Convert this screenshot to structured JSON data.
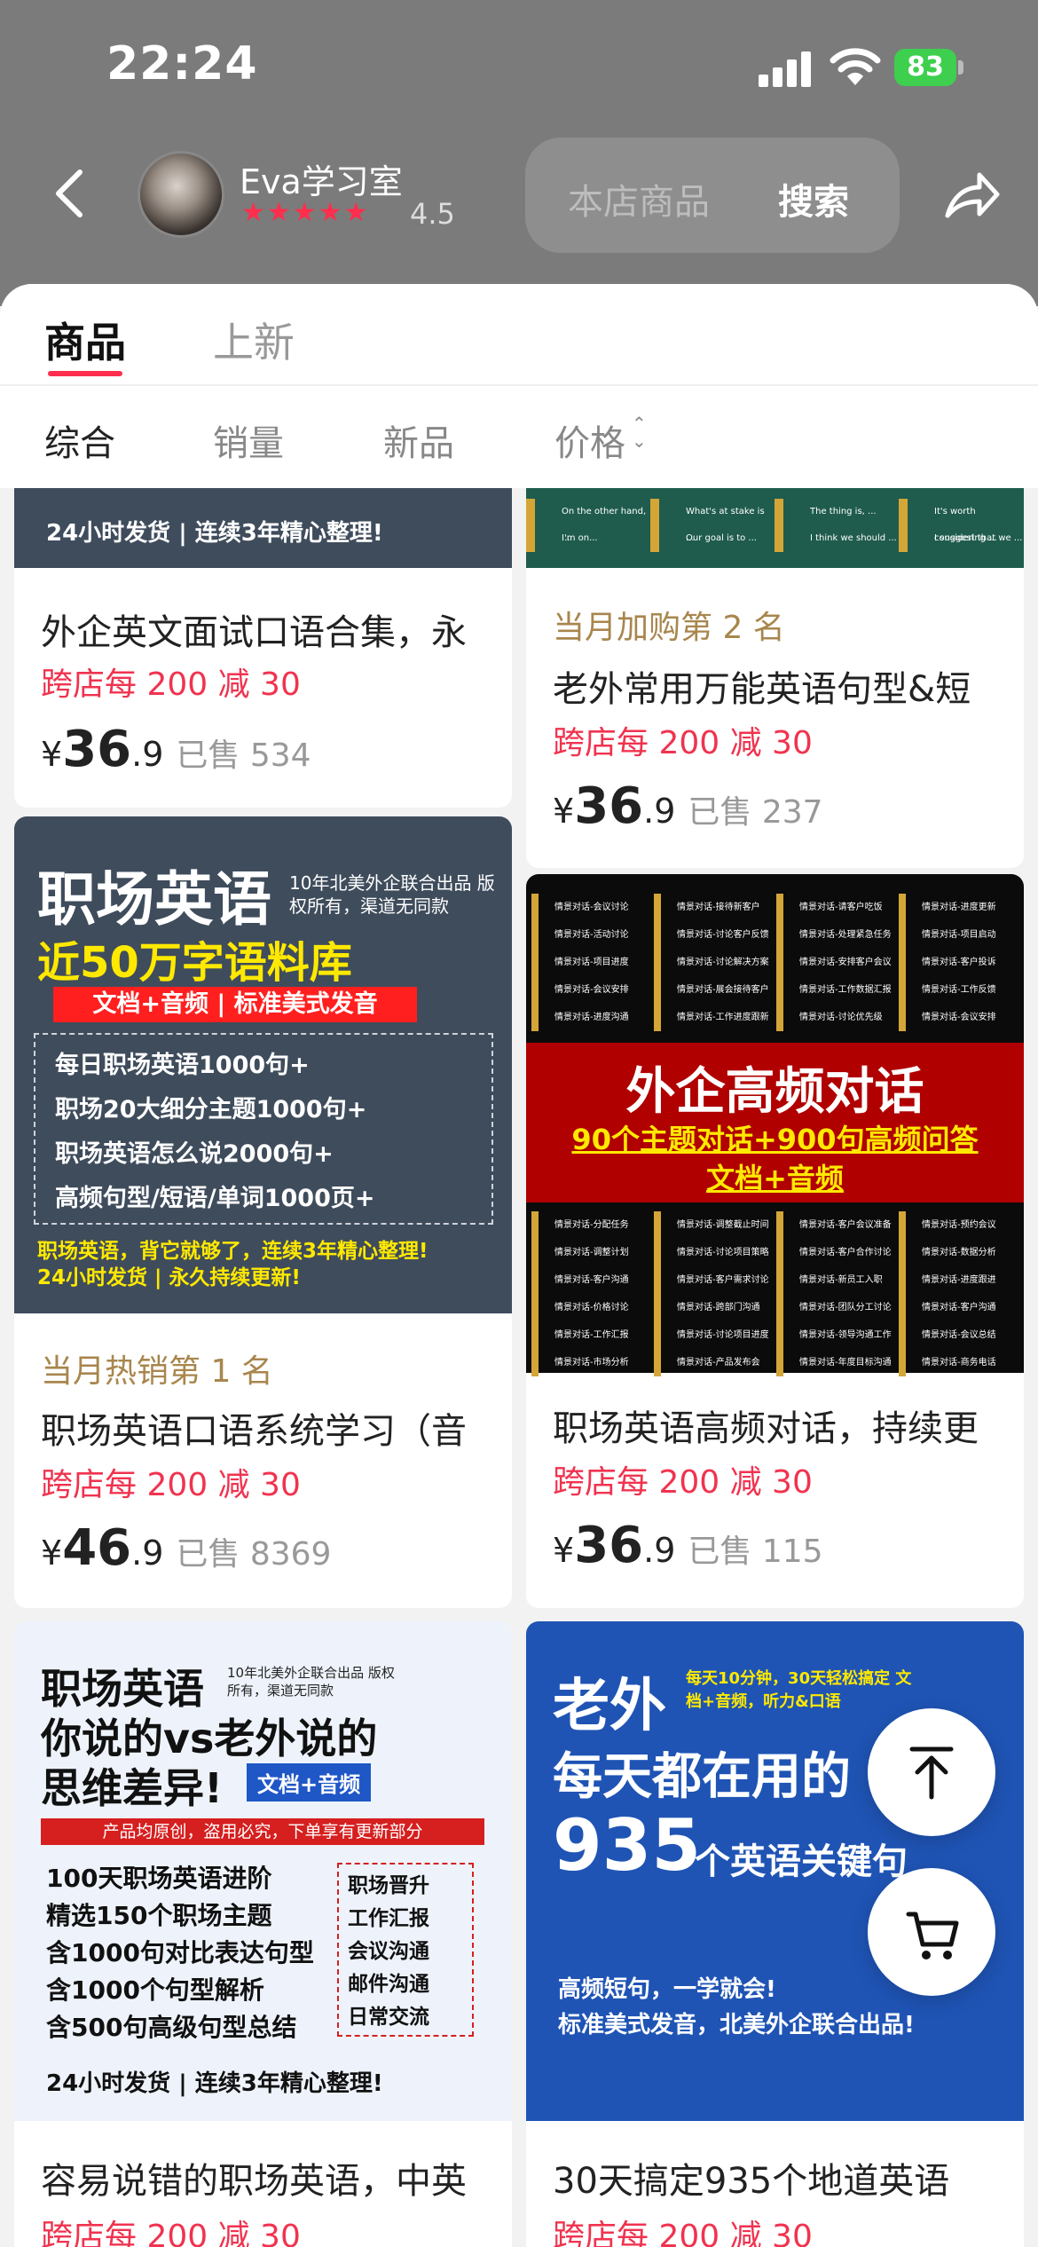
{
  "status_bar": {
    "time": "22:24",
    "battery": "83"
  },
  "shop": {
    "name": "Eva学习室",
    "stars": "★★★★★",
    "rating": "4.5"
  },
  "search": {
    "placeholder": "本店商品",
    "button": "搜索"
  },
  "tabs": [
    {
      "label": "商品"
    },
    {
      "label": "上新"
    }
  ],
  "sort": [
    "综合",
    "销量",
    "新品",
    "价格"
  ],
  "products": [
    {
      "banner": "24小时发货 | 连续3年精心整理!",
      "title": "外企英文面试口语合集，永",
      "rank": "",
      "promo": "跨店每 200 减 30",
      "currency": "¥",
      "price_int": "36",
      "price_dec": ".9",
      "sold": "已售 534"
    },
    {
      "chips": [
        "On the other hand, ...",
        "What's at stake is ...",
        "The thing is, ...",
        "It's worth considering ...",
        "I'm on...",
        "Our goal is to ...",
        "I think we should ...",
        "I suggest that we ..."
      ],
      "title": "老外常用万能英语句型&短",
      "rank": "当月加购第 2 名",
      "promo": "跨店每 200 减 30",
      "currency": "¥",
      "price_int": "36",
      "price_dec": ".9",
      "sold": "已售 237"
    },
    {
      "img": {
        "h1": "职场英语",
        "note": "10年北美外企联合出品 版权所有，渠道无同款",
        "h2": "近50万字语料库",
        "bar": "文档+音频 | 标准美式发音",
        "items": [
          "每日职场英语1000句+",
          "职场20大细分主题1000句+",
          "职场英语怎么说2000句+",
          "高频句型/短语/单词1000页+"
        ],
        "foot1": "职场英语，背它就够了，连续3年精心整理!",
        "foot2": "24小时发货 | 永久持续更新!"
      },
      "title": "职场英语口语系统学习（音",
      "rank": "当月热销第 1 名",
      "promo": "跨店每 200 减 30",
      "currency": "¥",
      "price_int": "46",
      "price_dec": ".9",
      "sold": "已售 8369"
    },
    {
      "img": {
        "h1": "外企高频对话",
        "h2": "90个主题对话+900句高频问答",
        "h3": "文档+音频",
        "chips_top": [
          "情景对话-会议讨论",
          "情景对话-接待新客户",
          "情景对话-请客户吃饭",
          "情景对话-进度更新",
          "情景对话-活动讨论",
          "情景对话-讨论客户反馈",
          "情景对话-处理紧急任务",
          "情景对话-项目启动",
          "情景对话-项目进度",
          "情景对话-讨论解决方案",
          "情景对话-安排客户会议",
          "情景对话-客户投诉",
          "情景对话-会议安排",
          "情景对话-展会接待客户",
          "情景对话-工作数据汇报",
          "情景对话-工作反馈",
          "情景对话-进度沟通",
          "情景对话-工作进度跟新",
          "情景对话-讨论优先级",
          "情景对话-会议安排"
        ],
        "chips_bottom": [
          "情景对话-分配任务",
          "情景对话-调整截止时间",
          "情景对话-客户会议准备",
          "情景对话-预约会议",
          "情景对话-调整计划",
          "情景对话-讨论项目策略",
          "情景对话-客户合作讨论",
          "情景对话-数据分析",
          "情景对话-客户沟通",
          "情景对话-客户需求讨论",
          "情景对话-新员工入职",
          "情景对话-进度跟进",
          "情景对话-价格讨论",
          "情景对话-跨部门沟通",
          "情景对话-团队分工讨论",
          "情景对话-客户沟通",
          "情景对话-工作汇报",
          "情景对话-讨论项目进度",
          "情景对话-领导沟通工作",
          "情景对话-会议总结",
          "情景对话-市场分析",
          "情景对话-产品发布会",
          "情景对话-年度目标沟通",
          "情景对话-商务电话"
        ]
      },
      "title": "职场英语高频对话，持续更",
      "rank": "",
      "promo": "跨店每 200 减 30",
      "currency": "¥",
      "price_int": "36",
      "price_dec": ".9",
      "sold": "已售 115"
    },
    {
      "img": {
        "h1": "职场英语",
        "note": "10年北美外企联合出品 版权所有，渠道无同款",
        "h2": "你说的vs老外说的",
        "h3": "思维差异!",
        "tag": "文档+音频",
        "bar": "产品均原创，盗用必究，下单享有更新部分",
        "lines": [
          "100天职场英语进阶",
          "精选150个职场主题",
          "含1000句对比表达句型",
          "含1000个句型解析",
          "含500句高级句型总结"
        ],
        "checks": [
          "职场晋升",
          "工作汇报",
          "会议沟通",
          "邮件沟通",
          "日常交流"
        ],
        "foot": "24小时发货 | 连续3年精心整理!"
      },
      "title": "容易说错的职场英语，中英",
      "rank": "",
      "promo": "跨店每 200 减 30"
    },
    {
      "img": {
        "h1": "老外",
        "note": "每天10分钟，30天轻松搞定 文档+音频，听力&口语",
        "h2": "每天都在用的",
        "num": "935",
        "h3": "个英语关键句",
        "sub1": "高频短句，一学就会!",
        "sub2": "标准美式发音，北美外企联合出品!"
      },
      "title": "30天搞定935个地道英语",
      "rank": "",
      "promo": "跨店每 200 减 30"
    }
  ]
}
